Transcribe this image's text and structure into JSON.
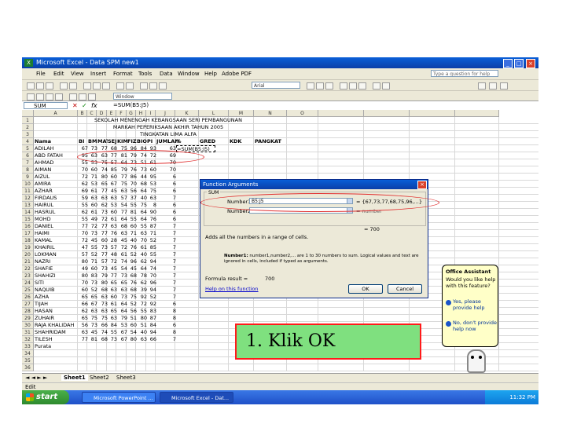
{
  "window": {
    "title": "Microsoft Excel - Data SPM new1"
  },
  "menu": [
    "File",
    "Edit",
    "View",
    "Insert",
    "Format",
    "Tools",
    "Data",
    "Window",
    "Help",
    "Adobe PDF"
  ],
  "help_placeholder": "Type a question for help",
  "toolbar": {
    "font_name": "Arial",
    "style_box": "Window"
  },
  "formula_bar": {
    "name_box": "SUM",
    "fx": "fx",
    "formula": "=SUM(B5:J5)"
  },
  "columns": [
    "A",
    "B",
    "C",
    "D",
    "E",
    "F",
    "G",
    "H",
    "I",
    "J",
    "K",
    "L",
    "M",
    "N",
    "O"
  ],
  "sheet": {
    "title1": "SEKOLAH MENENGAH KEBANGSAAN SERI PEMBANGUNAN",
    "title2": "MARKAH PEPERIKSAAN AKHIR TAHUN 2005",
    "title3": "TINGKATAN LIMA ALFA",
    "headers": [
      "Nama",
      "BI",
      "BM",
      "MAT",
      "SEJ",
      "KIM",
      "FIZ",
      "BIO",
      "PI",
      "JUMLAH",
      "%",
      "GRED",
      "KDK",
      "PANGKAT"
    ],
    "rows": [
      {
        "n": "5",
        "name": "ADILAH",
        "v": [
          "67",
          "73",
          "77",
          "68",
          "75",
          "96",
          "84",
          "93",
          "63"
        ],
        "total": "=SUM(B5:J5)"
      },
      {
        "n": "6",
        "name": "ABD FATAH",
        "v": [
          "95",
          "63",
          "63",
          "77",
          "81",
          "79",
          "74",
          "72",
          "69"
        ]
      },
      {
        "n": "7",
        "name": "AHMAD",
        "v": [
          "55",
          "53",
          "75",
          "57",
          "64",
          "73",
          "51",
          "61",
          "70"
        ]
      },
      {
        "n": "8",
        "name": "AIMAN",
        "v": [
          "70",
          "60",
          "74",
          "85",
          "79",
          "76",
          "73",
          "60",
          "70"
        ]
      },
      {
        "n": "9",
        "name": "AIZUL",
        "v": [
          "72",
          "71",
          "80",
          "60",
          "77",
          "86",
          "44",
          "95",
          "6"
        ]
      },
      {
        "n": "10",
        "name": "AMIRA",
        "v": [
          "62",
          "53",
          "65",
          "67",
          "75",
          "70",
          "68",
          "53",
          "6"
        ]
      },
      {
        "n": "11",
        "name": "AZHAR",
        "v": [
          "69",
          "61",
          "77",
          "45",
          "63",
          "56",
          "64",
          "75",
          "6"
        ]
      },
      {
        "n": "12",
        "name": "FIRDAUS",
        "v": [
          "59",
          "63",
          "63",
          "63",
          "57",
          "37",
          "40",
          "63",
          "7"
        ]
      },
      {
        "n": "13",
        "name": "HAIRUL",
        "v": [
          "55",
          "60",
          "62",
          "53",
          "54",
          "55",
          "75",
          "8",
          "6"
        ]
      },
      {
        "n": "14",
        "name": "HASRUL",
        "v": [
          "62",
          "61",
          "73",
          "60",
          "77",
          "81",
          "64",
          "90",
          "6"
        ]
      },
      {
        "n": "15",
        "name": "MOHD",
        "v": [
          "55",
          "49",
          "72",
          "61",
          "64",
          "55",
          "64",
          "76",
          "6"
        ]
      },
      {
        "n": "16",
        "name": "DANIEL",
        "v": [
          "77",
          "72",
          "77",
          "63",
          "68",
          "60",
          "55",
          "87",
          "7"
        ]
      },
      {
        "n": "17",
        "name": "HAIMI",
        "v": [
          "70",
          "73",
          "77",
          "76",
          "63",
          "71",
          "63",
          "71",
          "7"
        ]
      },
      {
        "n": "18",
        "name": "KAMAL",
        "v": [
          "72",
          "45",
          "60",
          "28",
          "45",
          "40",
          "70",
          "52",
          "7"
        ]
      },
      {
        "n": "19",
        "name": "KHAIRIL",
        "v": [
          "47",
          "55",
          "73",
          "57",
          "72",
          "76",
          "61",
          "85",
          "7"
        ]
      },
      {
        "n": "20",
        "name": "LOKMAN",
        "v": [
          "57",
          "52",
          "77",
          "48",
          "61",
          "52",
          "40",
          "55",
          "7"
        ]
      },
      {
        "n": "21",
        "name": "NAZRI",
        "v": [
          "80",
          "71",
          "57",
          "72",
          "74",
          "96",
          "62",
          "94",
          "7"
        ]
      },
      {
        "n": "22",
        "name": "SHAFIE",
        "v": [
          "49",
          "60",
          "73",
          "45",
          "54",
          "45",
          "64",
          "74",
          "7"
        ]
      },
      {
        "n": "23",
        "name": "SHAHIZI",
        "v": [
          "80",
          "83",
          "79",
          "77",
          "73",
          "68",
          "78",
          "70",
          "7"
        ]
      },
      {
        "n": "24",
        "name": "SITI",
        "v": [
          "70",
          "73",
          "80",
          "65",
          "65",
          "76",
          "62",
          "96",
          "7"
        ]
      },
      {
        "n": "25",
        "name": "NAQUIB",
        "v": [
          "60",
          "52",
          "68",
          "63",
          "63",
          "68",
          "39",
          "94",
          "7"
        ]
      },
      {
        "n": "26",
        "name": "AZHA",
        "v": [
          "65",
          "65",
          "63",
          "60",
          "73",
          "75",
          "92",
          "52",
          "7"
        ]
      },
      {
        "n": "27",
        "name": "TIJAH",
        "v": [
          "66",
          "67",
          "73",
          "61",
          "64",
          "52",
          "72",
          "92",
          "6"
        ]
      },
      {
        "n": "28",
        "name": "HASAN",
        "v": [
          "62",
          "63",
          "63",
          "65",
          "64",
          "56",
          "55",
          "83",
          "8"
        ]
      },
      {
        "n": "29",
        "name": "ZUHAIR",
        "v": [
          "65",
          "75",
          "75",
          "63",
          "79",
          "51",
          "80",
          "87",
          "8"
        ]
      },
      {
        "n": "30",
        "name": "RAJA KHALIDAH",
        "v": [
          "56",
          "73",
          "66",
          "84",
          "53",
          "60",
          "51",
          "84",
          "6"
        ]
      },
      {
        "n": "31",
        "name": "SHAHRIDAM",
        "v": [
          "63",
          "45",
          "74",
          "55",
          "67",
          "54",
          "40",
          "94",
          "8"
        ]
      },
      {
        "n": "32",
        "name": "TILESH",
        "v": [
          "77",
          "81",
          "68",
          "73",
          "67",
          "80",
          "63",
          "66",
          "7"
        ]
      },
      {
        "n": "33",
        "name": "Purata",
        "v": [
          "",
          "",
          "",
          "",
          "",
          "",
          "",
          "",
          ""
        ]
      }
    ]
  },
  "dialog": {
    "title": "Function Arguments",
    "group": "SUM",
    "number1_label": "Number1",
    "number1_value": "B5:J5",
    "number1_result": "= {67,73,77,68,75,96,...}",
    "number2_label": "Number2",
    "number2_result": "= number",
    "result_preview": "= 700",
    "desc": "Adds all the numbers in a range of cells.",
    "arg_help_bold": "Number1:",
    "arg_help": "number1,number2,... are 1 to 30 numbers to sum. Logical values and text are ignored in cells, included if typed as arguments.",
    "formula_result": "Formula result =",
    "formula_result_value": "700",
    "help_link": "Help on this function",
    "ok": "OK",
    "cancel": "Cancel"
  },
  "assistant": {
    "title": "Office Assistant",
    "question": "Would you like help with this feature?",
    "yes": "Yes, please provide help",
    "no": "No, don't provide help now"
  },
  "sheet_tabs": [
    "Sheet1",
    "Sheet2",
    "Sheet3"
  ],
  "status": "Edit",
  "taskbar": {
    "start": "start",
    "tasks": [
      "Microsoft PowerPoint ...",
      "Microsoft Excel - Dat..."
    ],
    "clock": "11:32 PM"
  },
  "callout": "1. Klik OK",
  "colors": {
    "xp_blue": "#0b3fa8",
    "callout_bg": "#7fe07f",
    "callout_border": "#ff1a1a"
  }
}
